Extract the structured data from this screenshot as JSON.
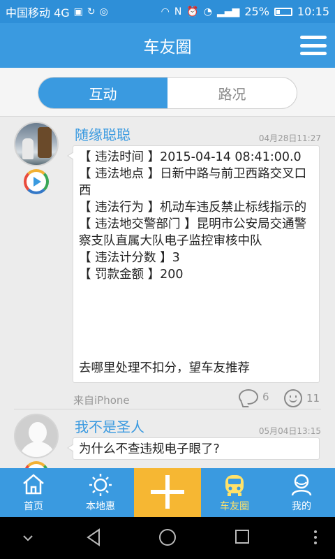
{
  "status_bar": {
    "carrier": "中国移动 4G",
    "network": "4G",
    "battery": "25%",
    "time": "10:15"
  },
  "app_bar": {
    "title": "车友圈"
  },
  "segment": {
    "tabs": [
      {
        "label": "互动",
        "active": true
      },
      {
        "label": "路况",
        "active": false
      }
    ]
  },
  "posts": [
    {
      "author": "随缘聪聪",
      "time": "04月28日11:27",
      "lines": [
        "【 违法时间 】2015-04-14 08:41:00.0",
        "【 违法地点 】日新中路与前卫西路交叉口西",
        "【 违法行为 】机动车违反禁止标线指示的",
        "【 违法地交警部门 】昆明市公安局交通警察支队直属大队电子监控审核中队",
        "【 违法计分数 】3",
        "【 罚款金额 】200"
      ],
      "footer_line": "去哪里处理不扣分，望车友推荐",
      "source": "来自iPhone",
      "comments": "6",
      "likes": "11"
    },
    {
      "author": "我不是圣人",
      "time": "05月04日13:15",
      "lines": [
        "为什么不查违规电子眼了?"
      ]
    }
  ],
  "tab_bar": {
    "items": [
      {
        "label": "首页",
        "icon": "home-icon"
      },
      {
        "label": "本地惠",
        "icon": "sun-icon"
      },
      {
        "label": "",
        "icon": "plus-icon"
      },
      {
        "label": "车友圈",
        "icon": "car-icon",
        "active": true
      },
      {
        "label": "我的",
        "icon": "person-icon"
      }
    ],
    "active_color": "#ffe26a",
    "center_color": "#f6b733"
  },
  "colors": {
    "primary": "#3a9ae0",
    "background": "#ececec"
  }
}
